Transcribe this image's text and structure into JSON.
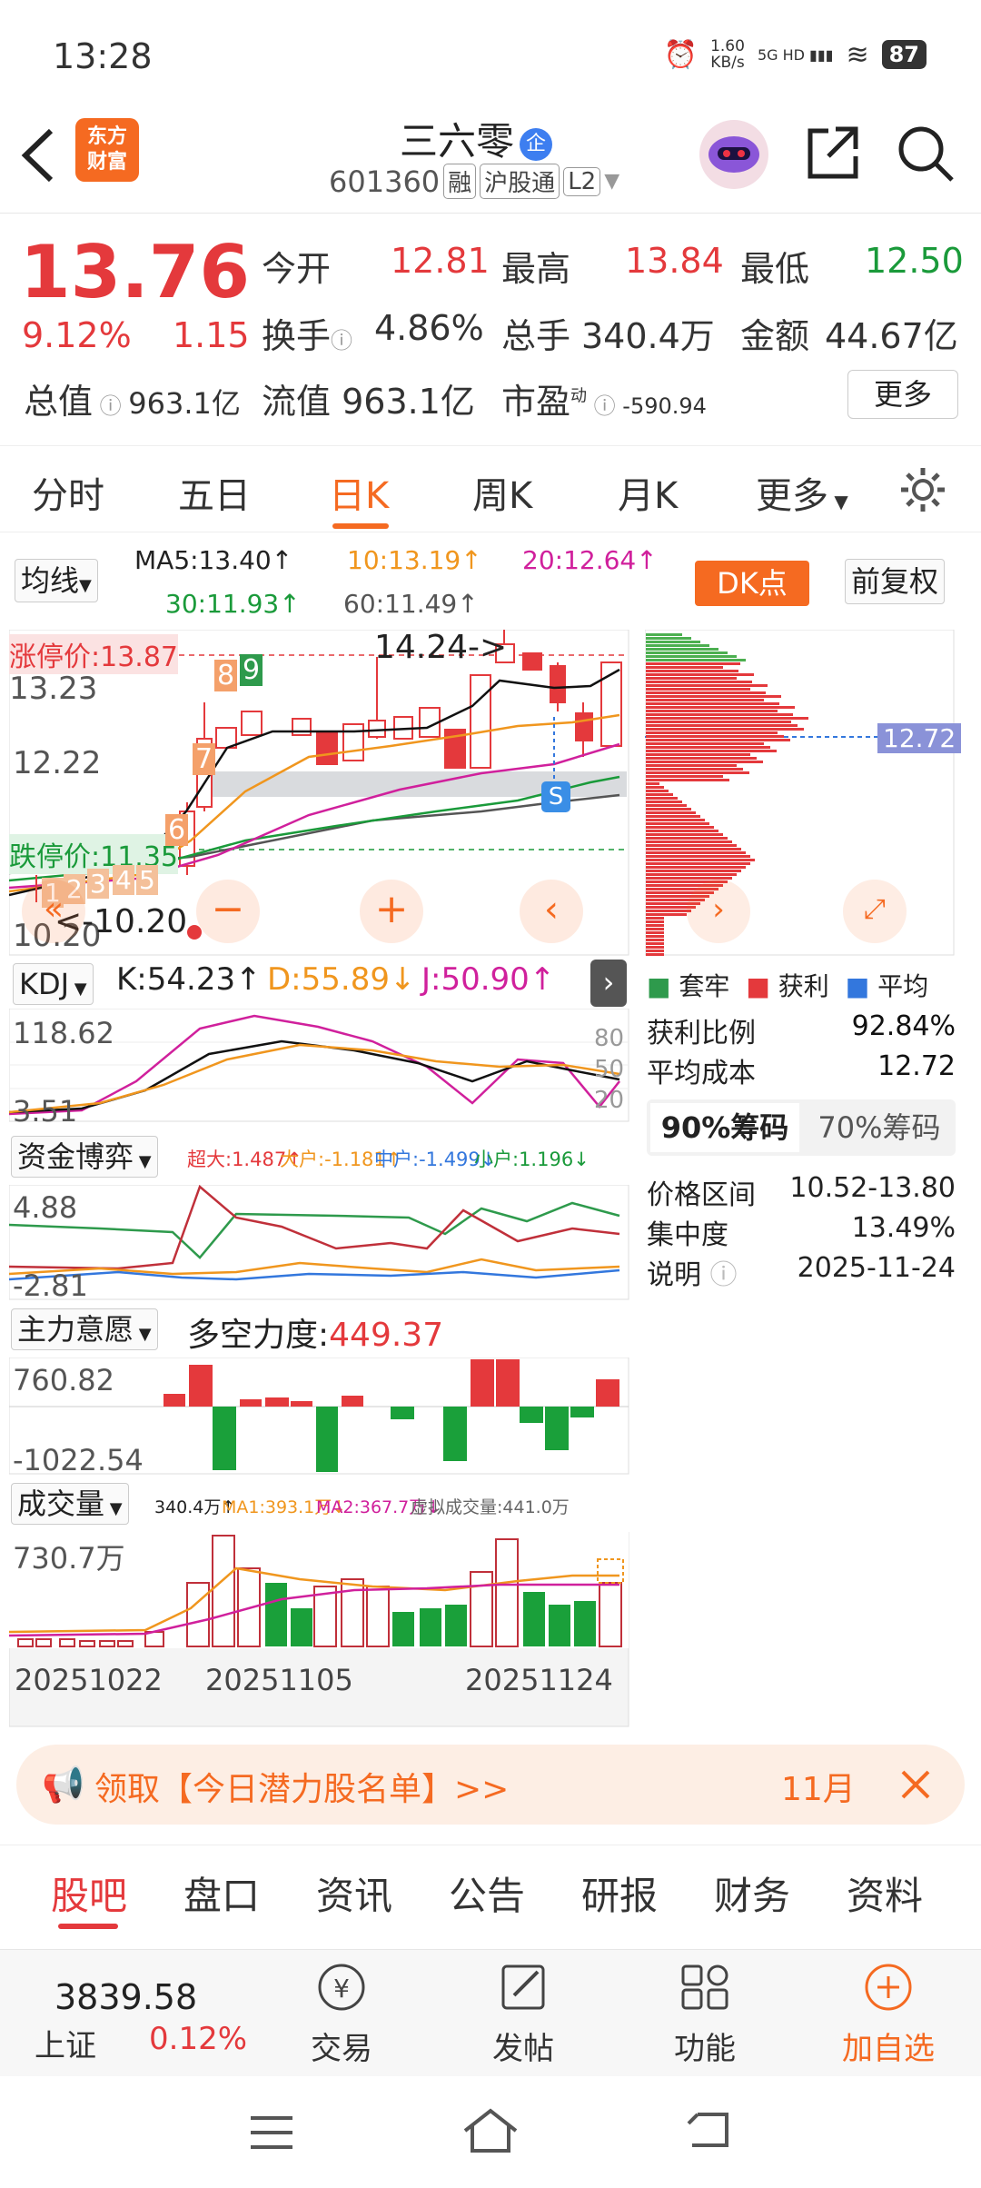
{
  "status": {
    "time": "13:28",
    "speed": "1.60\nKB/s",
    "net": "5G HD",
    "battery": "87"
  },
  "header": {
    "logo": "东方\n财富",
    "name": "三六零",
    "badge": "企",
    "code": "601360",
    "tags": [
      "融",
      "沪股通",
      "L2"
    ]
  },
  "quote": {
    "price": "13.76",
    "pct": "9.12%",
    "chg": "1.15",
    "open_l": "今开",
    "open": "12.81",
    "high_l": "最高",
    "high": "13.84",
    "low_l": "最低",
    "low": "12.50",
    "turn_l": "换手",
    "turn": "4.86%",
    "vol_l": "总手",
    "vol": "340.4万",
    "amt_l": "金额",
    "amt": "44.67亿",
    "mcap_l": "总值",
    "mcap": "963.1亿",
    "fcap_l": "流值",
    "fcap": "963.1亿",
    "pe_l": "市盈",
    "pe_sup": "动",
    "pe": "-590.94",
    "more": "更多"
  },
  "tabs": [
    "分时",
    "五日",
    "日K",
    "周K",
    "月K",
    "更多"
  ],
  "ma": {
    "select": "均线",
    "ma5": "MA5:13.40↑",
    "ma10": "10:13.19↑",
    "ma20": "20:12.64↑",
    "ma30": "30:11.93↑",
    "ma60": "60:11.49↑",
    "dk": "DK点",
    "fq": "前复权"
  },
  "kchart": {
    "zt": "涨停价:13.87",
    "dt": "跌停价:11.35",
    "y1": "14.24",
    "y2": "13.23",
    "y3": "12.22",
    "y4": "10.20",
    "hi": "14.24->",
    "lo": "<-10.20",
    "n8": "8",
    "n9": "9",
    "n7": "7",
    "n6": "6",
    "n5": "5",
    "n4": "4",
    "n3": "3",
    "n2": "2",
    "n1": "1",
    "s": "S",
    "chip_avg": "12.72"
  },
  "kdj": {
    "select": "KDJ",
    "k": "K:54.23↑",
    "d": "D:55.89↓",
    "j": "J:50.90↑",
    "y1": "118.62",
    "y2": "3.51",
    "r80": "80",
    "r50": "50",
    "r20": "20"
  },
  "zj": {
    "select": "资金博弈",
    "cd": "超大:1.487↑",
    "dh": "大户:-1.181↑",
    "zh": "中户:-1.499↓",
    "xh": "小户:1.196↓",
    "y1": "4.88",
    "y2": "-2.81"
  },
  "zl": {
    "select": "主力意愿",
    "label": "多空力度:",
    "val": "449.37",
    "y1": "760.82",
    "y2": "-1022.54"
  },
  "cjl": {
    "select": "成交量",
    "v": "340.4万↑",
    "ma1": "MA1:393.1万↓",
    "ma2": "MA2:367.7万↓",
    "xn": "虚拟成交量:441.0万",
    "y1": "730.7万",
    "d1": "20251022",
    "d2": "20251105",
    "d3": "20251124"
  },
  "chips": {
    "legend": [
      "套牢",
      "获利",
      "平均"
    ],
    "rows": [
      [
        "获利比例",
        "92.84%"
      ],
      [
        "平均成本",
        "12.72"
      ]
    ],
    "tab1": "90%筹码",
    "tab2": "70%筹码",
    "rows2": [
      [
        "价格区间",
        "10.52-13.80"
      ],
      [
        "集中度",
        "13.49%"
      ],
      [
        "说明",
        "2025-11-24"
      ]
    ]
  },
  "banner": {
    "text": "领取【今日潜力股名单】>>",
    "right": "11月"
  },
  "bottomtabs": [
    "股吧",
    "盘口",
    "资讯",
    "公告",
    "研报",
    "财务",
    "资料"
  ],
  "toolbar": {
    "index_val": "3839.58",
    "index_name": "上证",
    "index_pct": "0.12%",
    "trade": "交易",
    "post": "发帖",
    "func": "功能",
    "add": "加自选"
  },
  "colors": {
    "accent": "#f56a21",
    "up": "#e4393c",
    "down": "#1a9a3a"
  }
}
